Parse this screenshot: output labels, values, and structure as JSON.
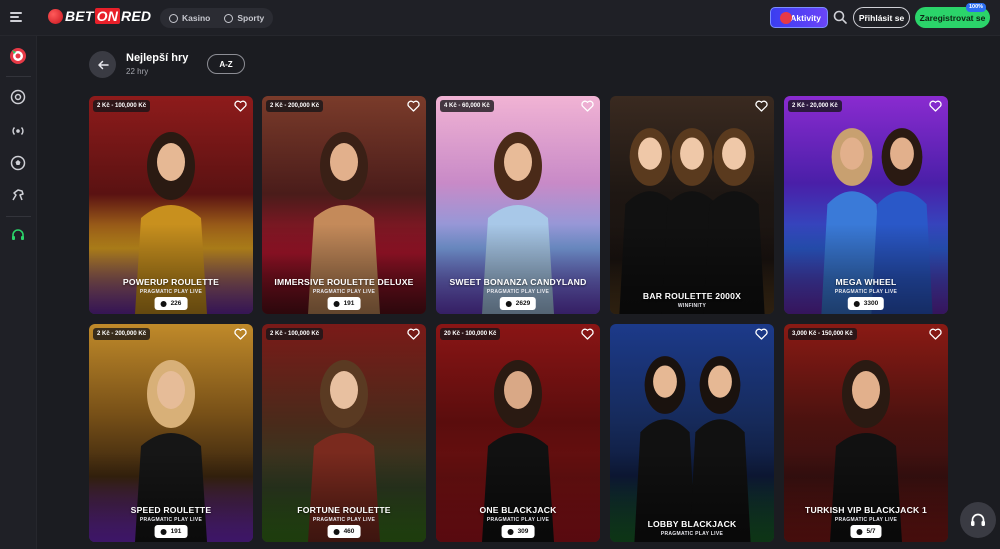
{
  "header": {
    "logo_text": {
      "bet": "BET",
      "on": "ON",
      "red": "RED"
    },
    "tabs": [
      {
        "label": "Kasino"
      },
      {
        "label": "Sporty"
      }
    ],
    "aktivity_label": "Aktivity",
    "login_label": "Přihlásit se",
    "register_label": "Zaregistrovat se",
    "bonus_badge": "100%"
  },
  "page": {
    "title": "Nejlepší hry",
    "count": "22 hry",
    "sort_label": "A-Z"
  },
  "colors": {
    "accent_green": "#2bd46a",
    "accent_purple": "#5b42f3",
    "brand_red": "#e8202a"
  },
  "games": [
    {
      "name": "POWERUP ROULETTE",
      "stake": "2 Kč - 100,000 Kč",
      "provider": "PRAGMATIC PLAY LIVE",
      "players": "226"
    },
    {
      "name": "IMMERSIVE ROULETTE DELUXE",
      "stake": "2 Kč - 200,000 Kč",
      "provider": "PRAGMATIC PLAY LIVE",
      "players": "191"
    },
    {
      "name": "SWEET BONANZA CANDYLAND",
      "stake": "4 Kč - 60,000 Kč",
      "provider": "PRAGMATIC PLAY LIVE",
      "players": "2629"
    },
    {
      "name": "BAR ROULETTE 2000X",
      "stake": "",
      "provider": "WINFINITY",
      "players": ""
    },
    {
      "name": "MEGA WHEEL",
      "stake": "2 Kč - 20,000 Kč",
      "provider": "PRAGMATIC PLAY LIVE",
      "players": "3300"
    },
    {
      "name": "SPEED ROULETTE",
      "stake": "2 Kč - 200,000 Kč",
      "provider": "PRAGMATIC PLAY LIVE",
      "players": "191"
    },
    {
      "name": "FORTUNE ROULETTE",
      "stake": "2 Kč - 100,000 Kč",
      "provider": "PRAGMATIC PLAY LIVE",
      "players": "460"
    },
    {
      "name": "ONE BLACKJACK",
      "stake": "20 Kč - 100,000 Kč",
      "provider": "PRAGMATIC PLAY LIVE",
      "players": "309"
    },
    {
      "name": "LOBBY BLACKJACK",
      "stake": "",
      "provider": "PRAGMATIC PLAY LIVE",
      "players": ""
    },
    {
      "name": "TURKISH VIP BLACKJACK 1",
      "stake": "3,000 Kč - 150,000 Kč",
      "provider": "PRAGMATIC PLAY LIVE",
      "players": "5/7"
    }
  ]
}
